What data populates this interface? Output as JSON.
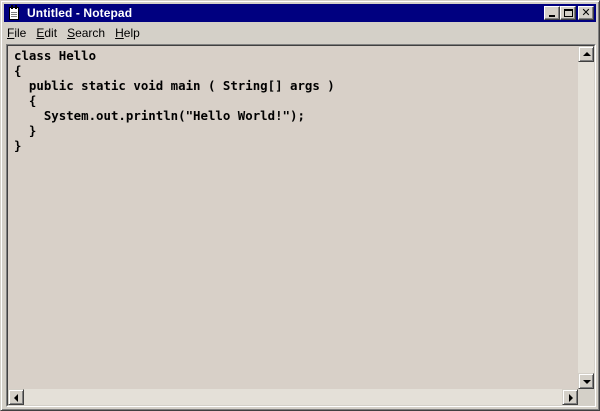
{
  "window": {
    "title": "Untitled - Notepad",
    "title_bar_color": "#000080",
    "face_color": "#d4d0c8",
    "app_icon": "notepad-icon"
  },
  "title_buttons": [
    {
      "name": "minimize",
      "icon": "minimize-icon"
    },
    {
      "name": "maximize",
      "icon": "maximize-icon"
    },
    {
      "name": "close",
      "icon": "close-icon",
      "glyph": "✕"
    }
  ],
  "menu": {
    "file": {
      "mnemonic": "F",
      "rest": "ile"
    },
    "edit": {
      "mnemonic": "E",
      "rest": "dit"
    },
    "search": {
      "mnemonic": "S",
      "rest": "earch"
    },
    "help": {
      "mnemonic": "H",
      "rest": "elp"
    }
  },
  "editor": {
    "text": "class Hello\n{\n  public static void main ( String[] args )\n  {\n    System.out.println(\"Hello World!\");\n  }\n}"
  }
}
